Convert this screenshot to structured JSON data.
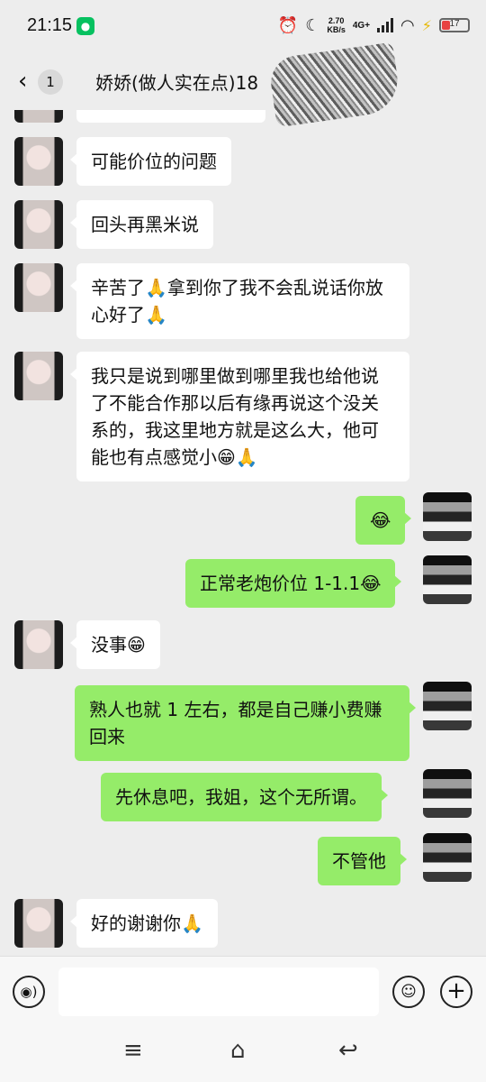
{
  "status_bar": {
    "time": "21:15",
    "wechat_icon": "wechat-icon",
    "alarm_icon": "alarm-icon",
    "moon_icon": "moon-icon",
    "net_speed_value": "2.70",
    "net_speed_unit": "KB/s",
    "network_type": "4G+",
    "battery_level": "17",
    "colors": {
      "battery_low": "#e84343",
      "wechat_green": "#07c160"
    }
  },
  "header": {
    "back_icon": "chevron-left-icon",
    "unread_count": "1",
    "title": "娇娇(做人实在点)18"
  },
  "colors": {
    "incoming_bubble": "#ffffff",
    "outgoing_bubble": "#95ec69",
    "background": "#ededed"
  },
  "messages": [
    {
      "side": "left",
      "text": "可能价位的问题"
    },
    {
      "side": "left",
      "text": "回头再黑米说"
    },
    {
      "side": "left",
      "text": "辛苦了🙏拿到你了我不会乱说话你放心好了🙏"
    },
    {
      "side": "left",
      "text": "我只是说到哪里做到哪里我也给他说了不能合作那以后有缘再说这个没关系的，我这里地方就是这么大，他可能也有点感觉小😁🙏"
    },
    {
      "side": "right",
      "text": "😂"
    },
    {
      "side": "right",
      "text": "正常老炮价位 1-1.1😂"
    },
    {
      "side": "left",
      "text": "没事😁"
    },
    {
      "side": "right",
      "text": "熟人也就 1 左右，都是自己赚小费赚回来"
    },
    {
      "side": "right",
      "text": "先休息吧，我姐，这个无所谓。"
    },
    {
      "side": "right",
      "text": "不管他"
    },
    {
      "side": "left",
      "text": "好的谢谢你🙏"
    }
  ],
  "input_bar": {
    "voice_icon": "voice-icon",
    "text_value": "",
    "emoji_icon": "smiley-icon",
    "plus_icon": "plus-icon"
  },
  "nav_bar": {
    "menu_icon": "menu-icon",
    "home_icon": "home-icon",
    "back_icon": "back-arrow-icon"
  }
}
